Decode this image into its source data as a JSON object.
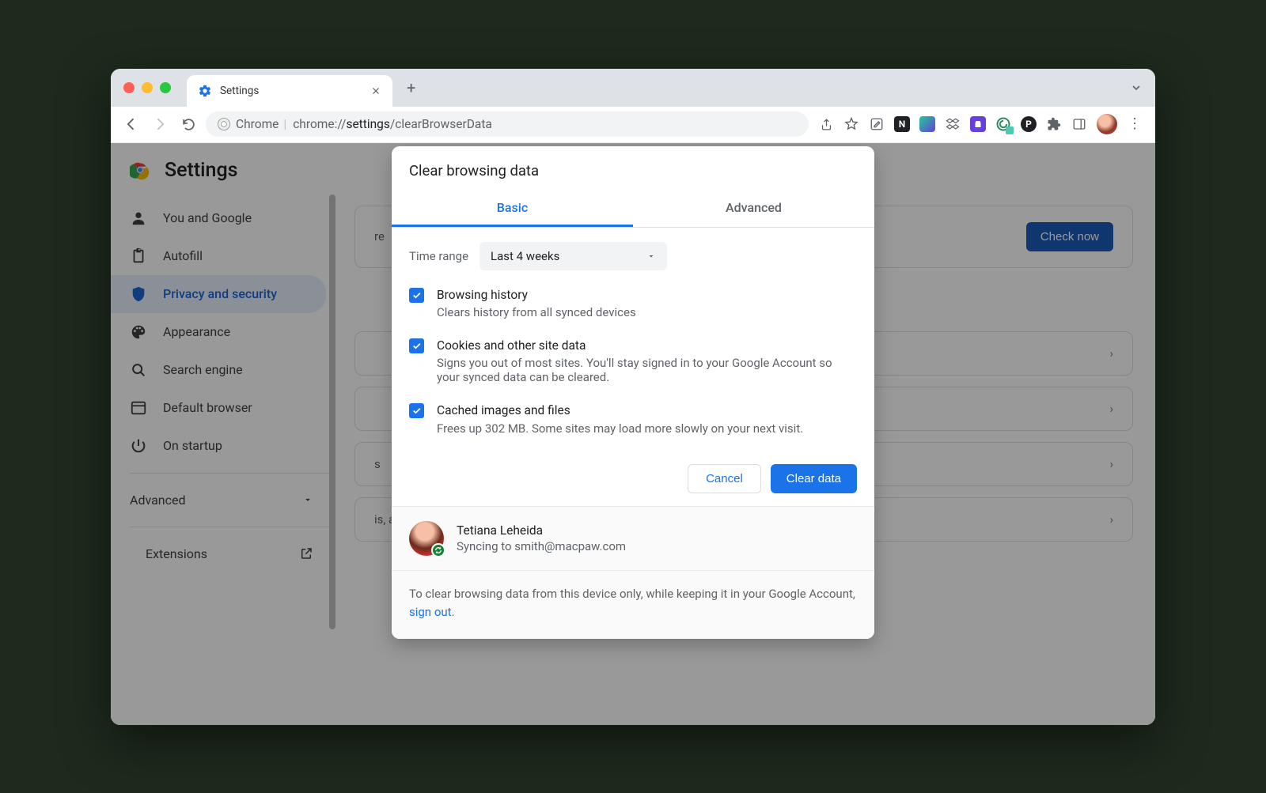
{
  "browser": {
    "tab_title": "Settings",
    "url_prefix": "Chrome",
    "url_scheme": "chrome://",
    "url_host": "settings",
    "url_path": "/clearBrowserData"
  },
  "settings": {
    "title": "Settings",
    "sidebar": {
      "items": [
        {
          "label": "You and Google",
          "key": "you-and-google"
        },
        {
          "label": "Autofill",
          "key": "autofill"
        },
        {
          "label": "Privacy and security",
          "key": "privacy-security",
          "active": true
        },
        {
          "label": "Appearance",
          "key": "appearance"
        },
        {
          "label": "Search engine",
          "key": "search-engine"
        },
        {
          "label": "Default browser",
          "key": "default-browser"
        },
        {
          "label": "On startup",
          "key": "on-startup"
        }
      ],
      "advanced": "Advanced",
      "extensions": "Extensions"
    },
    "main": {
      "card_text_suffix": "re",
      "check_now": "Check now",
      "row_suffix_1": "s",
      "row_suffix_2": "is, and more)"
    }
  },
  "dialog": {
    "title": "Clear browsing data",
    "tabs": {
      "basic": "Basic",
      "advanced": "Advanced"
    },
    "time_range_label": "Time range",
    "time_range_value": "Last 4 weeks",
    "options": [
      {
        "title": "Browsing history",
        "desc": "Clears history from all synced devices"
      },
      {
        "title": "Cookies and other site data",
        "desc": "Signs you out of most sites. You'll stay signed in to your Google Account so your synced data can be cleared."
      },
      {
        "title": "Cached images and files",
        "desc": "Frees up 302 MB. Some sites may load more slowly on your next visit."
      }
    ],
    "cancel": "Cancel",
    "clear": "Clear data",
    "user": {
      "name": "Tetiana Leheida",
      "sync": "Syncing to smith@macpaw.com"
    },
    "footer_pre": "To clear browsing data from this device only, while keeping it in your Google Account, ",
    "footer_link": "sign out",
    "footer_post": "."
  }
}
